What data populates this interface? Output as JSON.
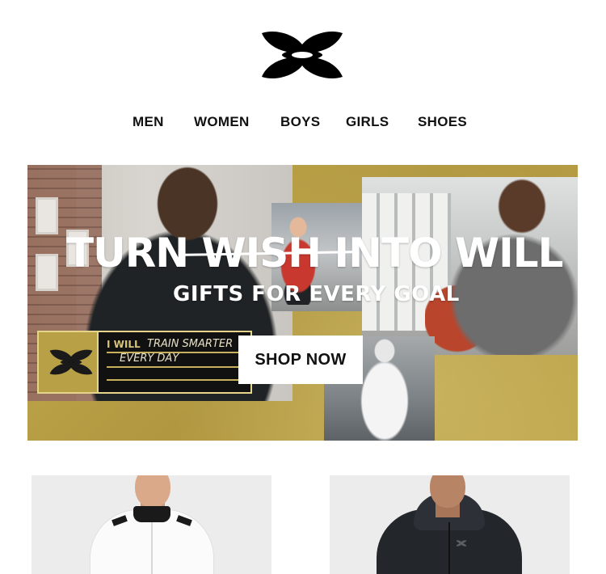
{
  "brand": {
    "logo_icon": "under-armour-logo-icon",
    "logo_color": "#000000"
  },
  "nav": {
    "items": [
      {
        "label": "MEN"
      },
      {
        "label": "WOMEN"
      },
      {
        "label": "BOYS"
      },
      {
        "label": "GIRLS"
      },
      {
        "label": "SHOES"
      }
    ]
  },
  "hero": {
    "headline_part1": "TURN",
    "headline_strike": "WISH",
    "headline_part2": "INTO WILL",
    "subheadline": "GIFTS FOR EVERY GOAL",
    "badge": {
      "label": "I WILL",
      "line1": "TRAIN SMARTER",
      "line2": "EVERY DAY"
    },
    "cta_label": "SHOP NOW",
    "accent_color": "#b7a045"
  },
  "products": [
    {
      "name_icon": "white-quarter-zip-jacket-image"
    },
    {
      "name_icon": "black-hooded-jacket-image"
    }
  ]
}
